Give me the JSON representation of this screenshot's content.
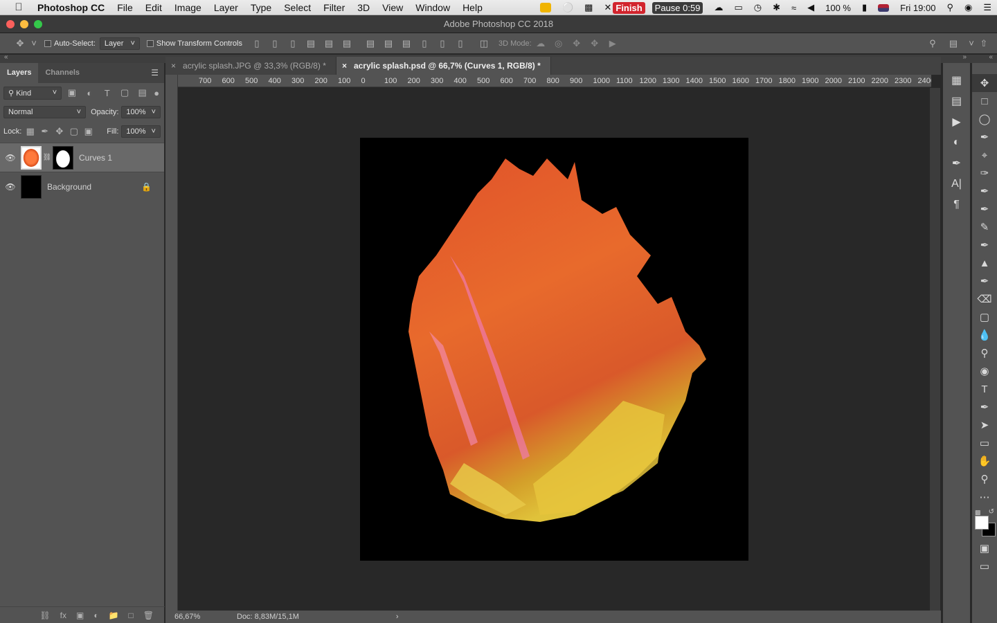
{
  "menubar": {
    "app": "Photoshop CC",
    "items": [
      "File",
      "Edit",
      "Image",
      "Layer",
      "Type",
      "Select",
      "Filter",
      "3D",
      "View",
      "Window",
      "Help"
    ],
    "finish_label": "Finish",
    "pause_label": "Pause 0:59",
    "battery": "100 %",
    "clock": "Fri 19:00"
  },
  "window": {
    "title": "Adobe Photoshop CC 2018"
  },
  "options": {
    "auto_select_label": "Auto-Select:",
    "auto_select_value": "Layer",
    "show_transform_label": "Show Transform Controls",
    "mode_3d_label": "3D Mode:"
  },
  "layers_panel": {
    "tabs": [
      "Layers",
      "Channels"
    ],
    "filter_kind": "Kind",
    "blend_mode": "Normal",
    "opacity_label": "Opacity:",
    "opacity_value": "100%",
    "lock_label": "Lock:",
    "fill_label": "Fill:",
    "fill_value": "100%",
    "layers": [
      {
        "name": "Curves 1",
        "selected": true
      },
      {
        "name": "Background",
        "selected": false
      }
    ]
  },
  "documents": {
    "tabs": [
      {
        "title": "acrylic splash.JPG @ 33,3% (RGB/8) *",
        "active": false
      },
      {
        "title": "acrylic splash.psd @ 66,7% (Curves 1, RGB/8) *",
        "active": true
      }
    ]
  },
  "ruler": {
    "h_ticks": [
      "700",
      "600",
      "500",
      "400",
      "300",
      "200",
      "100",
      "0",
      "100",
      "200",
      "300",
      "400",
      "500",
      "600",
      "700",
      "800",
      "900",
      "1000",
      "1100",
      "1200",
      "1300",
      "1400",
      "1500",
      "1600",
      "1700",
      "1800",
      "1900",
      "2000",
      "2100",
      "2200",
      "2300",
      "2400"
    ]
  },
  "status": {
    "zoom": "66,67%",
    "doc": "Doc: 8,83M/15,1M"
  },
  "colors": {
    "panel": "#535353",
    "canvas_bg": "#282828",
    "artboard": "#000000",
    "accent_red": "#d2242d"
  }
}
